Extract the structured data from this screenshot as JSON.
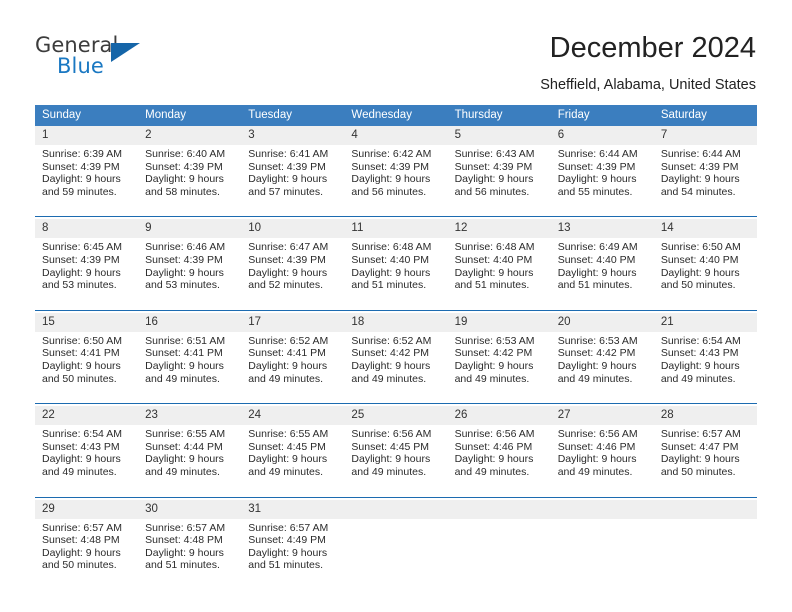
{
  "brand": {
    "name_part1": "General",
    "name_part2": "Blue",
    "accent_color": "#1565a8"
  },
  "header": {
    "title": "December 2024",
    "location": "Sheffield, Alabama, United States"
  },
  "calendar": {
    "header_color": "#3b7ebf",
    "weekdays": [
      "Sunday",
      "Monday",
      "Tuesday",
      "Wednesday",
      "Thursday",
      "Friday",
      "Saturday"
    ],
    "weeks": [
      [
        {
          "day": "1",
          "sunrise": "Sunrise: 6:39 AM",
          "sunset": "Sunset: 4:39 PM",
          "daylight_line1": "Daylight: 9 hours",
          "daylight_line2": "and 59 minutes."
        },
        {
          "day": "2",
          "sunrise": "Sunrise: 6:40 AM",
          "sunset": "Sunset: 4:39 PM",
          "daylight_line1": "Daylight: 9 hours",
          "daylight_line2": "and 58 minutes."
        },
        {
          "day": "3",
          "sunrise": "Sunrise: 6:41 AM",
          "sunset": "Sunset: 4:39 PM",
          "daylight_line1": "Daylight: 9 hours",
          "daylight_line2": "and 57 minutes."
        },
        {
          "day": "4",
          "sunrise": "Sunrise: 6:42 AM",
          "sunset": "Sunset: 4:39 PM",
          "daylight_line1": "Daylight: 9 hours",
          "daylight_line2": "and 56 minutes."
        },
        {
          "day": "5",
          "sunrise": "Sunrise: 6:43 AM",
          "sunset": "Sunset: 4:39 PM",
          "daylight_line1": "Daylight: 9 hours",
          "daylight_line2": "and 56 minutes."
        },
        {
          "day": "6",
          "sunrise": "Sunrise: 6:44 AM",
          "sunset": "Sunset: 4:39 PM",
          "daylight_line1": "Daylight: 9 hours",
          "daylight_line2": "and 55 minutes."
        },
        {
          "day": "7",
          "sunrise": "Sunrise: 6:44 AM",
          "sunset": "Sunset: 4:39 PM",
          "daylight_line1": "Daylight: 9 hours",
          "daylight_line2": "and 54 minutes."
        }
      ],
      [
        {
          "day": "8",
          "sunrise": "Sunrise: 6:45 AM",
          "sunset": "Sunset: 4:39 PM",
          "daylight_line1": "Daylight: 9 hours",
          "daylight_line2": "and 53 minutes."
        },
        {
          "day": "9",
          "sunrise": "Sunrise: 6:46 AM",
          "sunset": "Sunset: 4:39 PM",
          "daylight_line1": "Daylight: 9 hours",
          "daylight_line2": "and 53 minutes."
        },
        {
          "day": "10",
          "sunrise": "Sunrise: 6:47 AM",
          "sunset": "Sunset: 4:39 PM",
          "daylight_line1": "Daylight: 9 hours",
          "daylight_line2": "and 52 minutes."
        },
        {
          "day": "11",
          "sunrise": "Sunrise: 6:48 AM",
          "sunset": "Sunset: 4:40 PM",
          "daylight_line1": "Daylight: 9 hours",
          "daylight_line2": "and 51 minutes."
        },
        {
          "day": "12",
          "sunrise": "Sunrise: 6:48 AM",
          "sunset": "Sunset: 4:40 PM",
          "daylight_line1": "Daylight: 9 hours",
          "daylight_line2": "and 51 minutes."
        },
        {
          "day": "13",
          "sunrise": "Sunrise: 6:49 AM",
          "sunset": "Sunset: 4:40 PM",
          "daylight_line1": "Daylight: 9 hours",
          "daylight_line2": "and 51 minutes."
        },
        {
          "day": "14",
          "sunrise": "Sunrise: 6:50 AM",
          "sunset": "Sunset: 4:40 PM",
          "daylight_line1": "Daylight: 9 hours",
          "daylight_line2": "and 50 minutes."
        }
      ],
      [
        {
          "day": "15",
          "sunrise": "Sunrise: 6:50 AM",
          "sunset": "Sunset: 4:41 PM",
          "daylight_line1": "Daylight: 9 hours",
          "daylight_line2": "and 50 minutes."
        },
        {
          "day": "16",
          "sunrise": "Sunrise: 6:51 AM",
          "sunset": "Sunset: 4:41 PM",
          "daylight_line1": "Daylight: 9 hours",
          "daylight_line2": "and 49 minutes."
        },
        {
          "day": "17",
          "sunrise": "Sunrise: 6:52 AM",
          "sunset": "Sunset: 4:41 PM",
          "daylight_line1": "Daylight: 9 hours",
          "daylight_line2": "and 49 minutes."
        },
        {
          "day": "18",
          "sunrise": "Sunrise: 6:52 AM",
          "sunset": "Sunset: 4:42 PM",
          "daylight_line1": "Daylight: 9 hours",
          "daylight_line2": "and 49 minutes."
        },
        {
          "day": "19",
          "sunrise": "Sunrise: 6:53 AM",
          "sunset": "Sunset: 4:42 PM",
          "daylight_line1": "Daylight: 9 hours",
          "daylight_line2": "and 49 minutes."
        },
        {
          "day": "20",
          "sunrise": "Sunrise: 6:53 AM",
          "sunset": "Sunset: 4:42 PM",
          "daylight_line1": "Daylight: 9 hours",
          "daylight_line2": "and 49 minutes."
        },
        {
          "day": "21",
          "sunrise": "Sunrise: 6:54 AM",
          "sunset": "Sunset: 4:43 PM",
          "daylight_line1": "Daylight: 9 hours",
          "daylight_line2": "and 49 minutes."
        }
      ],
      [
        {
          "day": "22",
          "sunrise": "Sunrise: 6:54 AM",
          "sunset": "Sunset: 4:43 PM",
          "daylight_line1": "Daylight: 9 hours",
          "daylight_line2": "and 49 minutes."
        },
        {
          "day": "23",
          "sunrise": "Sunrise: 6:55 AM",
          "sunset": "Sunset: 4:44 PM",
          "daylight_line1": "Daylight: 9 hours",
          "daylight_line2": "and 49 minutes."
        },
        {
          "day": "24",
          "sunrise": "Sunrise: 6:55 AM",
          "sunset": "Sunset: 4:45 PM",
          "daylight_line1": "Daylight: 9 hours",
          "daylight_line2": "and 49 minutes."
        },
        {
          "day": "25",
          "sunrise": "Sunrise: 6:56 AM",
          "sunset": "Sunset: 4:45 PM",
          "daylight_line1": "Daylight: 9 hours",
          "daylight_line2": "and 49 minutes."
        },
        {
          "day": "26",
          "sunrise": "Sunrise: 6:56 AM",
          "sunset": "Sunset: 4:46 PM",
          "daylight_line1": "Daylight: 9 hours",
          "daylight_line2": "and 49 minutes."
        },
        {
          "day": "27",
          "sunrise": "Sunrise: 6:56 AM",
          "sunset": "Sunset: 4:46 PM",
          "daylight_line1": "Daylight: 9 hours",
          "daylight_line2": "and 49 minutes."
        },
        {
          "day": "28",
          "sunrise": "Sunrise: 6:57 AM",
          "sunset": "Sunset: 4:47 PM",
          "daylight_line1": "Daylight: 9 hours",
          "daylight_line2": "and 50 minutes."
        }
      ],
      [
        {
          "day": "29",
          "sunrise": "Sunrise: 6:57 AM",
          "sunset": "Sunset: 4:48 PM",
          "daylight_line1": "Daylight: 9 hours",
          "daylight_line2": "and 50 minutes."
        },
        {
          "day": "30",
          "sunrise": "Sunrise: 6:57 AM",
          "sunset": "Sunset: 4:48 PM",
          "daylight_line1": "Daylight: 9 hours",
          "daylight_line2": "and 51 minutes."
        },
        {
          "day": "31",
          "sunrise": "Sunrise: 6:57 AM",
          "sunset": "Sunset: 4:49 PM",
          "daylight_line1": "Daylight: 9 hours",
          "daylight_line2": "and 51 minutes."
        },
        {
          "day": "",
          "sunrise": "",
          "sunset": "",
          "daylight_line1": "",
          "daylight_line2": ""
        },
        {
          "day": "",
          "sunrise": "",
          "sunset": "",
          "daylight_line1": "",
          "daylight_line2": ""
        },
        {
          "day": "",
          "sunrise": "",
          "sunset": "",
          "daylight_line1": "",
          "daylight_line2": ""
        },
        {
          "day": "",
          "sunrise": "",
          "sunset": "",
          "daylight_line1": "",
          "daylight_line2": ""
        }
      ]
    ]
  }
}
